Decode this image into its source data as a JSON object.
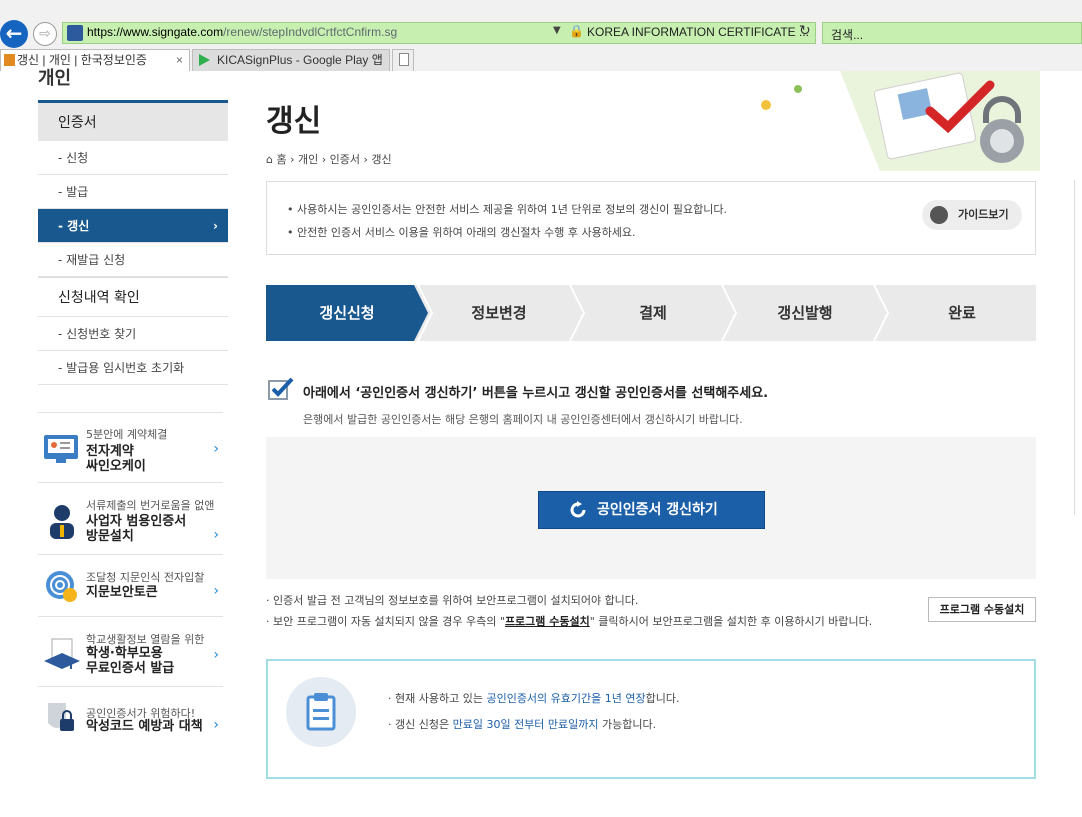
{
  "browser": {
    "url_host": "https://www.signgate.com",
    "url_path": "/renew/stepIndvdlCrtfctCnfirm.sg",
    "cert_label": "KOREA INFORMATION CERTIFICATE ...",
    "search_placeholder": "검색...",
    "tabs": [
      {
        "label": "갱신 | 개인 | 한국정보인증",
        "close": "×"
      },
      {
        "label": "KICASignPlus - Google Play 앱"
      }
    ]
  },
  "sidebar": {
    "cut_title": "개인",
    "section1": "인증서",
    "items": [
      {
        "label": "- 신청"
      },
      {
        "label": "- 발급"
      },
      {
        "label": "- 갱신",
        "chevron": "›"
      },
      {
        "label": "- 재발급 신청"
      }
    ],
    "section2": "신청내역 확인",
    "items2": [
      {
        "label": "- 신청번호 찾기"
      },
      {
        "label": "- 발급용 임시번호 초기화"
      }
    ],
    "promos": [
      {
        "small": "5분안에 계약체결",
        "big1": "전자계약",
        "big2": "싸인오케이",
        "arrow": "›"
      },
      {
        "small": "서류제출의 번거로움을 없앤",
        "big1": "사업자 범용인증서",
        "big2": "방문설치",
        "arrow": "›"
      },
      {
        "small": "조달청 지문인식 전자입찰",
        "big1": "지문보안토큰",
        "big2": "",
        "arrow": "›"
      },
      {
        "small": "학교생활정보 열람을 위한",
        "big1": "학생·학부모용",
        "big2": "무료인증서  발급",
        "arrow": "›"
      },
      {
        "small": "공인인증서가 위험하다!",
        "big1": "악성코드 예방과 대책",
        "big2": "",
        "arrow": "›"
      }
    ]
  },
  "main": {
    "title": "갱신",
    "breadcrumb": "홈  ›  개인  ›  인증서  ›  갱신",
    "info": [
      "•  사용하시는 공인인증서는 안전한 서비스 제공을 위하여 1년 단위로 정보의 갱신이 필요합니다.",
      "•  안전한 인증서 서비스 이용을 위하여 아래의 갱신절차 수행 후 사용하세요."
    ],
    "guide_button": "가이드보기",
    "steps": [
      "갱신신청",
      "정보변경",
      "결제",
      "갱신발행",
      "완료"
    ],
    "active_step": 0,
    "instruction": "아래에서 ‘공인인증서 갱신하기’ 버튼을 누르시고 갱신할 공인인증서를 선택해주세요.",
    "instruction_sub": "은행에서 발급한 공인인증서는 해당 은행의 홈페이지 내 공인인증센터에서 갱신하시기 바랍니다.",
    "renew_button": "공인인증서 갱신하기",
    "note1": "· 인증서 발급 전 고객님의 정보보호를 위하여 보안프로그램이 설치되어야 합니다.",
    "note2_pre": "· 보안 프로그램이 자동 설치되지 않을 경우 우측의 \"",
    "note2_link": "프로그램 수동설치",
    "note2_post": "\" 클릭하시어 보안프로그램을 설치한 후 이용하시기 바랍니다.",
    "manual_install_button": "프로그램 수동설치",
    "tip1_pre": "·  현재 사용하고 있는 ",
    "tip1_hl": "공인인증서의 유효기간을 1년 연장",
    "tip1_post": "합니다.",
    "tip2_pre": "·  갱신 신청은 ",
    "tip2_hl": "만료일 30일 전부터 만료일까지",
    "tip2_post": " 가능합니다."
  },
  "colors": {
    "brand_blue": "#19578f",
    "button_blue": "#1b5fa8",
    "address_bar_green": "#c6efb0",
    "tip_border": "#a3dde8"
  }
}
